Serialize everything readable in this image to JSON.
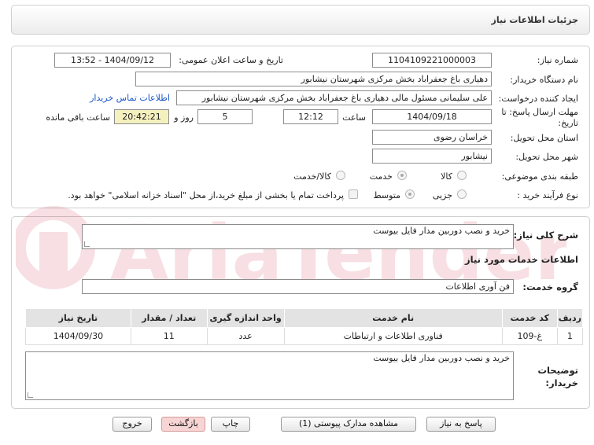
{
  "header": {
    "title": "جزئیات اطلاعات نیاز"
  },
  "form": {
    "need_number_label": "شماره نیاز:",
    "need_number": "1104109221000003",
    "announce_label": "تاریخ و ساعت اعلان عمومی:",
    "announce_value": "1404/09/12 - 13:52",
    "buyer_org_label": "نام دستگاه خریدار:",
    "buyer_org": "دهیاری باغ جعفراباد بخش مرکزی شهرستان نیشابور",
    "creator_label": "ایجاد کننده درخواست:",
    "creator": "علی سلیمانی مسئول مالی دهیاری باغ جعفراباد بخش مرکزی شهرستان نیشابور",
    "contact_link": "اطلاعات تماس خریدار",
    "deadline_label_1": "مهلت ارسال پاسخ: تا",
    "deadline_label_2": "تاریخ:",
    "deadline_date": "1404/09/18",
    "time_label": "ساعت",
    "deadline_time": "12:12",
    "days_value": "5",
    "days_label": "روز و",
    "remaining_time": "20:42:21",
    "remaining_label": "ساعت باقی مانده",
    "province_label": "استان محل تحویل:",
    "province": "خراسان رضوی",
    "city_label": "شهر محل تحویل:",
    "city": "نیشابور",
    "category_label": "طبقه بندی موضوعی:",
    "category_options": [
      "کالا",
      "خدمت",
      "کالا/خدمت"
    ],
    "process_label": "نوع فرآیند خرید :",
    "process_options": [
      "جزیی",
      "متوسط"
    ],
    "payment_note": "پرداخت تمام یا بخشی از مبلغ خرید،از محل \"اسناد خزانه اسلامی\" خواهد بود."
  },
  "summary": {
    "label": "شرح کلی نیاز:",
    "value": "خرید و نصب دوربین مدار فایل بیوست"
  },
  "services": {
    "section_title": "اطلاعات خدمات مورد نیاز",
    "group_label": "گروه خدمت:",
    "group_value": "فن آوری اطلاعات",
    "columns": [
      "ردیف",
      "کد خدمت",
      "نام خدمت",
      "واحد اندازه گیری",
      "تعداد / مقدار",
      "تاریخ نیاز"
    ],
    "rows": [
      [
        "1",
        "غ-109",
        "فناوری اطلاعات و ارتباطات",
        "عدد",
        "11",
        "1404/09/30"
      ]
    ]
  },
  "buyer_notes": {
    "label_1": "توضیحات",
    "label_2": "خریدار:",
    "value": "خرید و نصب دوربین مدار فایل بیوست"
  },
  "buttons": {
    "reply": "پاسخ به نیاز",
    "attachments": "مشاهده مدارک پیوستی (1)",
    "print": "چاپ",
    "back": "بازگشت",
    "exit": "خروج"
  },
  "watermark": {
    "text": "AriaTender.net"
  },
  "colors": {
    "link": "#1a56c8",
    "remaining_bg": "#f4f1bf",
    "back_button": "#f7d5d5",
    "watermark": "#c8102e"
  }
}
